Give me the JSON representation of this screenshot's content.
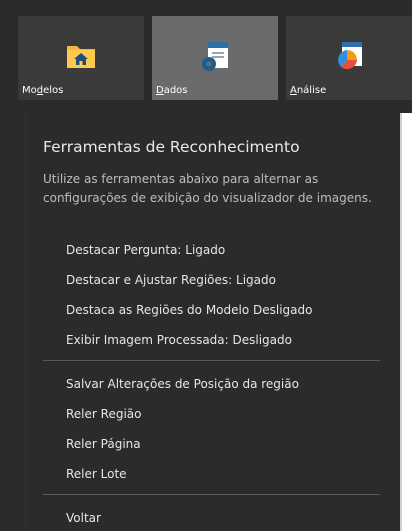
{
  "ribbon": {
    "tabs": [
      {
        "label_pre": "Mo",
        "label_ul": "d",
        "label_post": "elos",
        "icon": "folder-home-icon"
      },
      {
        "label_pre": "",
        "label_ul": "D",
        "label_post": "ados",
        "icon": "document-gear-icon"
      },
      {
        "label_pre": "",
        "label_ul": "A",
        "label_post": "nálise",
        "icon": "pie-chart-icon"
      }
    ],
    "selected": "Dados"
  },
  "panel": {
    "title": "Ferramentas de Reconhecimento",
    "description": "Utilize as ferramentas abaixo para alternar as configurações de exibição do visualizador de imagens.",
    "toggles": [
      "Destacar Pergunta: Ligado",
      "Destacar e Ajustar Regiões: Ligado",
      "Destaca as Regiões do Modelo Desligado",
      "Exibir Imagem Processada: Desligado"
    ],
    "actions": [
      "Salvar Alterações de Posição da região",
      "Reler Região",
      "Reler Página",
      "Reler Lote"
    ],
    "back": "Voltar"
  },
  "colors": {
    "background": "#2b2b2b",
    "tile": "#3a3a3a",
    "tile_selected": "#6b6b6b",
    "folder": "#f4b942",
    "gear": "#1e5f8a",
    "pie_blue": "#2f8fe0",
    "pie_orange": "#f39c12",
    "pie_red": "#e74c3c"
  }
}
